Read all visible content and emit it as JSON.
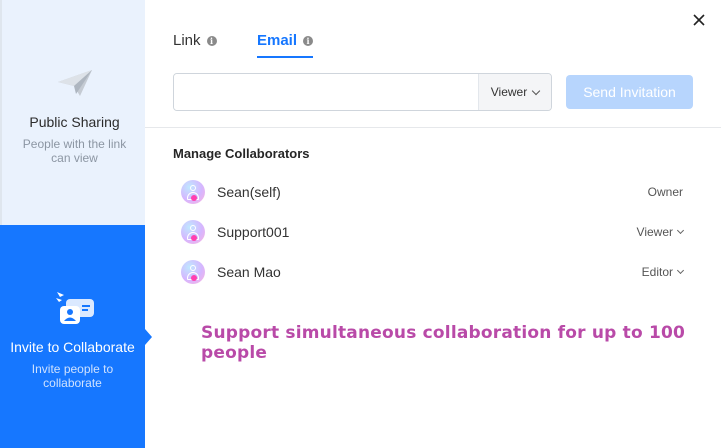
{
  "sidebar": {
    "public_sharing": {
      "title": "Public Sharing",
      "subtitle": "People with the link can view",
      "icon": "paper-plane-icon"
    },
    "invite": {
      "title": "Invite to Collaborate",
      "subtitle": "Invite people to collaborate",
      "icon": "invite-collaborator-icon",
      "active": true
    }
  },
  "tabs": [
    {
      "label": "Link",
      "active": false
    },
    {
      "label": "Email",
      "active": true
    }
  ],
  "invite_form": {
    "email_value": "",
    "role_selected": "Viewer",
    "send_label": "Send Invitation"
  },
  "collaborators": {
    "title": "Manage Collaborators",
    "items": [
      {
        "name": "Sean(self)",
        "role": "Owner",
        "has_dropdown": false
      },
      {
        "name": "Support001",
        "role": "Viewer",
        "has_dropdown": true
      },
      {
        "name": "Sean Mao",
        "role": "Editor",
        "has_dropdown": true
      }
    ]
  },
  "promo_text": "Support simultaneous collaboration for up to 100 people",
  "colors": {
    "accent": "#1677ff",
    "sidebar_bg": "#e9f2fe",
    "send_disabled": "#b7d5fd",
    "promo": "#b94aa8"
  }
}
